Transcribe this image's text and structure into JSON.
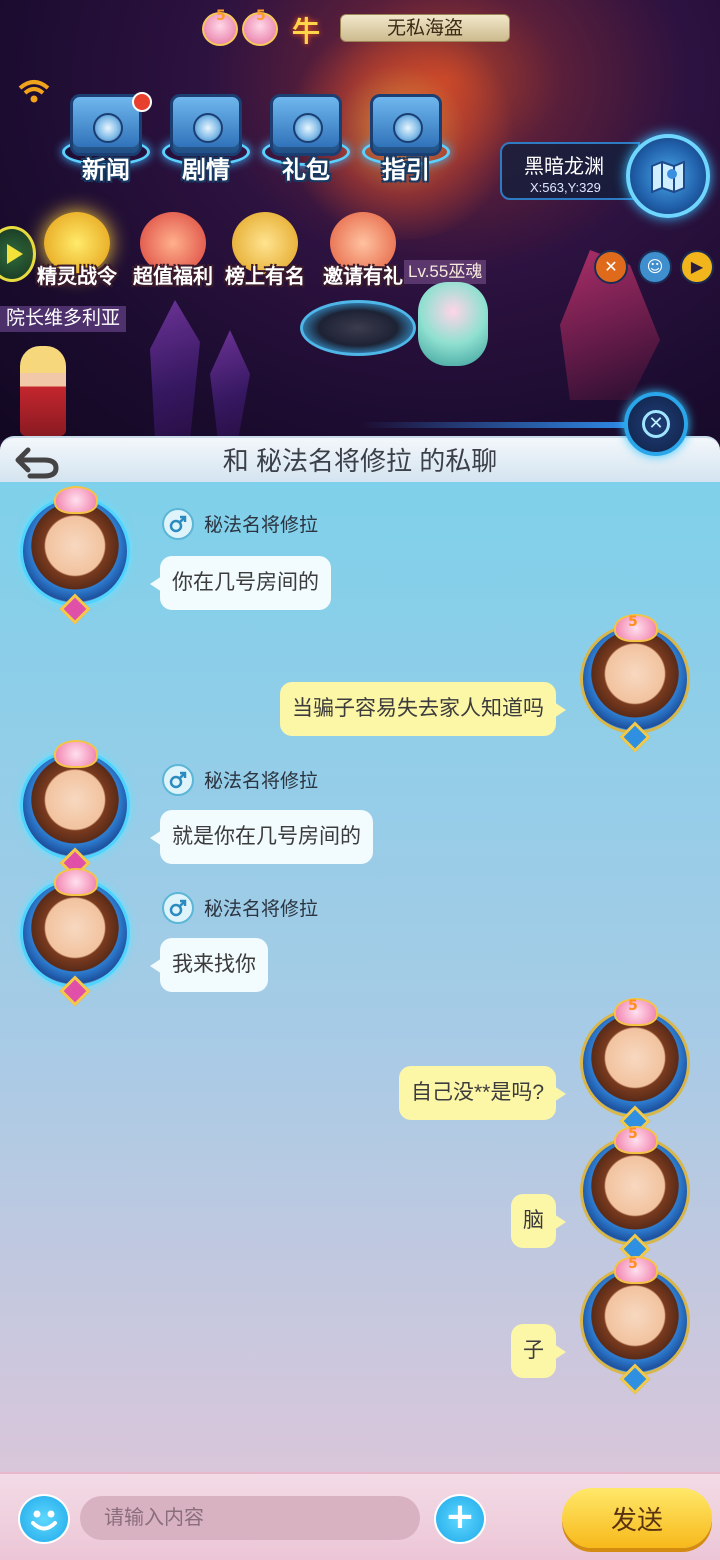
{
  "scene": {
    "banner_title": "无私海盗",
    "banner_badges": [
      "5",
      "5"
    ],
    "banner_mark": "牛",
    "menu": [
      {
        "label": "新闻",
        "notify": true
      },
      {
        "label": "剧情",
        "notify": false
      },
      {
        "label": "礼包",
        "notify": false
      },
      {
        "label": "指引",
        "notify": false
      }
    ],
    "events": [
      "精灵战令",
      "超值福利",
      "榜上有名",
      "邀请有礼"
    ],
    "map": {
      "name": "黑暗龙渊",
      "coords": "X:563,Y:329"
    },
    "npc_name": "院长维多利亚",
    "pet_level": "Lv.55巫魂",
    "icons": [
      "play-icon",
      "wifi-icon",
      "map-icon",
      "no-sound-icon",
      "face-icon",
      "skip-icon",
      "close-icon"
    ]
  },
  "chat": {
    "title": "和 秘法名将修拉 的私聊",
    "messages": [
      {
        "side": "in",
        "sender": "秘法名将修拉",
        "text": "你在几号房间的"
      },
      {
        "side": "out",
        "text": "当骗子容易失去家人知道吗",
        "level": "5"
      },
      {
        "side": "in",
        "sender": "秘法名将修拉",
        "text": "就是你在几号房间的"
      },
      {
        "side": "in",
        "sender": "秘法名将修拉",
        "text": "我来找你"
      },
      {
        "side": "out",
        "text": "自己没**是吗?",
        "level": "5"
      },
      {
        "side": "out",
        "text": "脑",
        "level": "5"
      },
      {
        "side": "out",
        "text": "子",
        "level": "5"
      }
    ]
  },
  "input": {
    "placeholder": "请输入内容",
    "send_label": "发送",
    "plus_label": "+"
  },
  "colors": {
    "bubble_in": "#f2fbfe",
    "bubble_out": "#fcf6a7",
    "send_button": "#f7b91b",
    "accent_blue": "#1ea8e8"
  }
}
